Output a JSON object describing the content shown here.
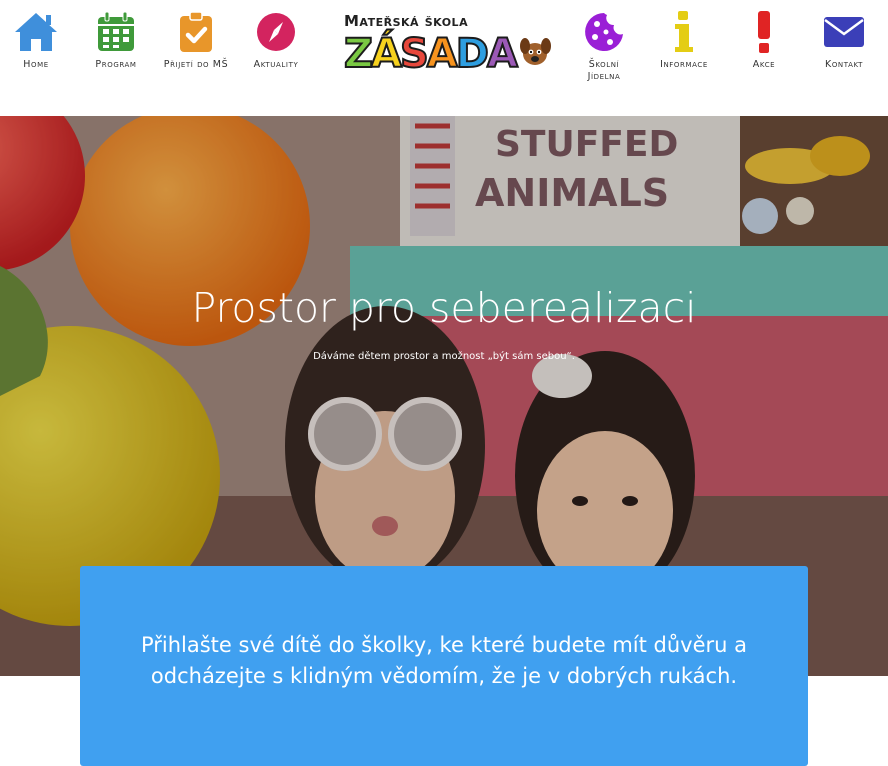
{
  "nav_left": [
    {
      "label": "Home",
      "icon": "home-icon",
      "color": "#3f8fdb"
    },
    {
      "label": "Program",
      "icon": "calendar-icon",
      "color": "#3f9a3a"
    },
    {
      "label": "Přijetí do MŠ",
      "icon": "clipboard-check-icon",
      "color": "#e8962a"
    },
    {
      "label": "Aktuality",
      "icon": "compass-icon",
      "color": "#d3245f"
    }
  ],
  "nav_right": [
    {
      "label": "Školní Jídelna",
      "icon": "cookie-icon",
      "color": "#9a1fd6"
    },
    {
      "label": "Informace",
      "icon": "info-icon",
      "color": "#e4cd14"
    },
    {
      "label": "Akce",
      "icon": "exclamation-icon",
      "color": "#e02424"
    },
    {
      "label": "Kontakt",
      "icon": "envelope-icon",
      "color": "#3b3fb8"
    }
  ],
  "logo": {
    "top_text": "Mateřská škola",
    "main_letters": [
      "Z",
      "Á",
      "S",
      "A",
      "D",
      "A"
    ],
    "letter_colors": [
      "#7ac943",
      "#f7d21e",
      "#e8483c",
      "#f7931e",
      "#2e9ee0",
      "#9b59b6"
    ]
  },
  "hero": {
    "title": "Prostor pro seberealizaci",
    "subtitle": "Dáváme dětem prostor a možnost „být sám sebou“."
  },
  "callout": {
    "text": "Přihlašte své dítě do školky, ke které budete mít důvěru a odcházejte s klidným vědomím, že je v dobrých rukách.",
    "color": "#40a0f0"
  }
}
